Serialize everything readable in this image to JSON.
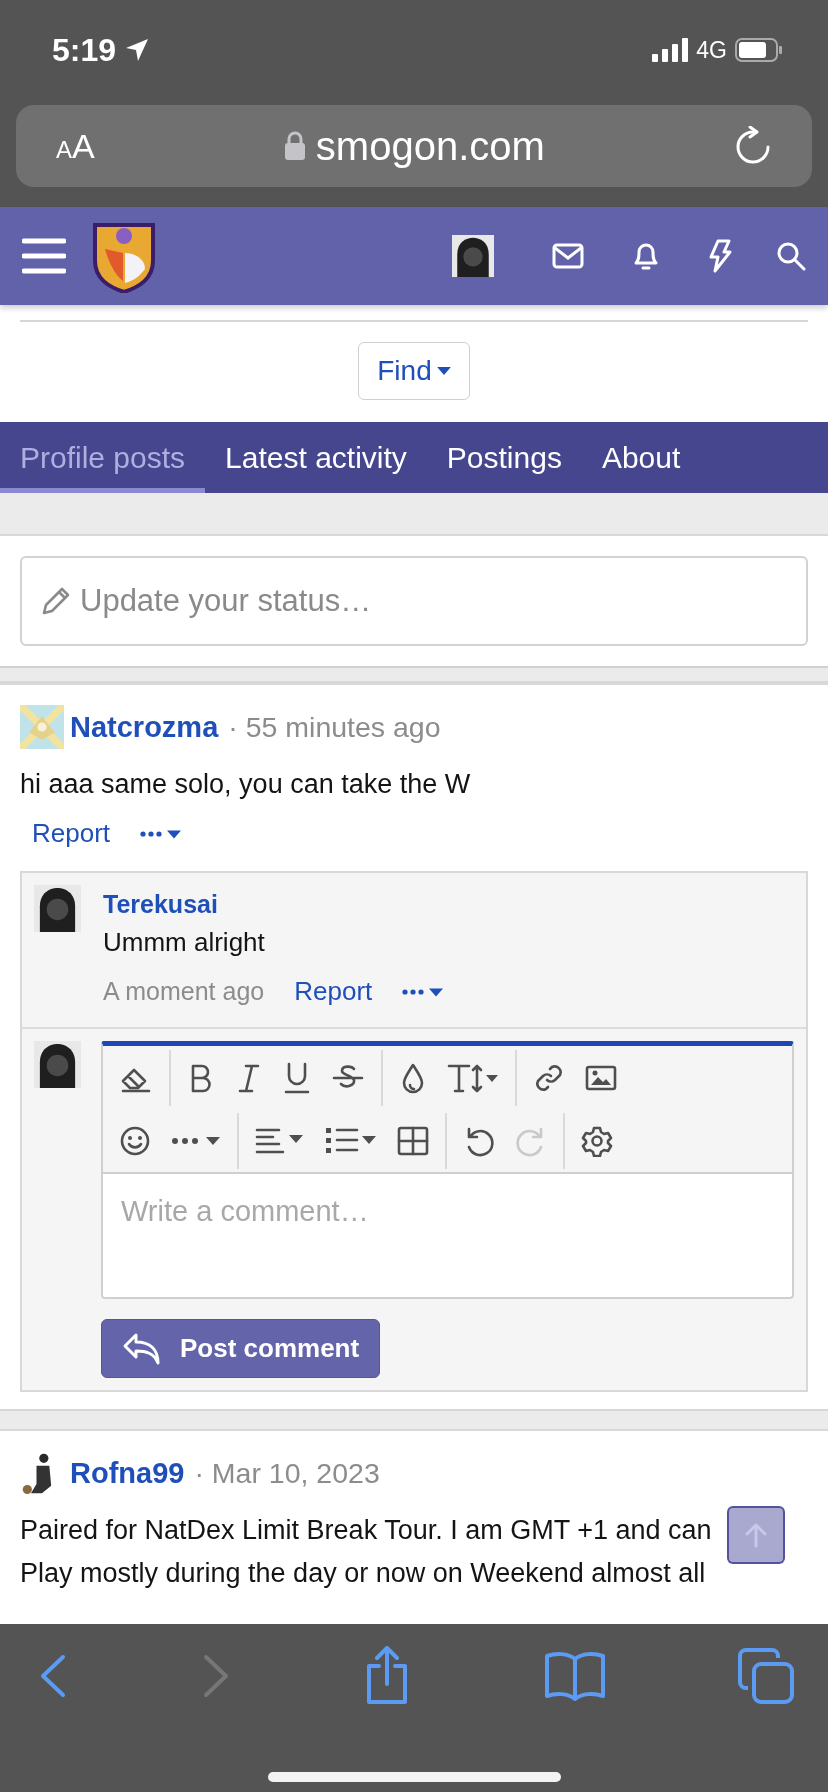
{
  "status_bar": {
    "time": "5:19",
    "network": "4G"
  },
  "browser": {
    "text_size_button": "AA",
    "url": "smogon.com"
  },
  "find_button": "Find",
  "tabs": [
    {
      "label": "Profile posts",
      "selected": true
    },
    {
      "label": "Latest activity",
      "selected": false
    },
    {
      "label": "Postings",
      "selected": false
    },
    {
      "label": "About",
      "selected": false
    }
  ],
  "status_field": {
    "placeholder": "Update your status…"
  },
  "posts": [
    {
      "author": "Natcrozma",
      "meta": "· 55 minutes ago",
      "body": "hi aaa same solo, you can take the W",
      "action": "Report",
      "comments": [
        {
          "author": "Terekusai",
          "body": "Ummm alright",
          "time": "A moment ago",
          "action": "Report"
        }
      ],
      "reply": {
        "placeholder": "Write a comment…",
        "button": "Post comment",
        "toolbar": [
          [
            [
              {
                "kind": "eraser",
                "disabled": false
              }
            ],
            [
              {
                "kind": "bold",
                "disabled": false
              },
              {
                "kind": "italic",
                "disabled": false
              },
              {
                "kind": "underline",
                "disabled": false
              },
              {
                "kind": "strike",
                "disabled": false
              }
            ],
            [
              {
                "kind": "color",
                "disabled": false
              },
              {
                "kind": "size",
                "disabled": false
              }
            ],
            [
              {
                "kind": "link",
                "disabled": false
              },
              {
                "kind": "image",
                "disabled": false
              }
            ]
          ],
          [
            [
              {
                "kind": "smiley",
                "disabled": false
              },
              {
                "kind": "more",
                "disabled": false
              }
            ],
            [
              {
                "kind": "align",
                "disabled": false
              },
              {
                "kind": "list",
                "disabled": false
              },
              {
                "kind": "table",
                "disabled": false
              }
            ],
            [
              {
                "kind": "undo",
                "disabled": false
              },
              {
                "kind": "redo",
                "disabled": true
              }
            ],
            [
              {
                "kind": "gear",
                "disabled": false
              }
            ]
          ]
        ]
      }
    },
    {
      "author": "Rofna99",
      "meta": "· Mar 10, 2023",
      "body": "Paired for NatDex Limit Break Tour. I am GMT +1 and can Play mostly during the day or now on Weekend almost all"
    }
  ]
}
